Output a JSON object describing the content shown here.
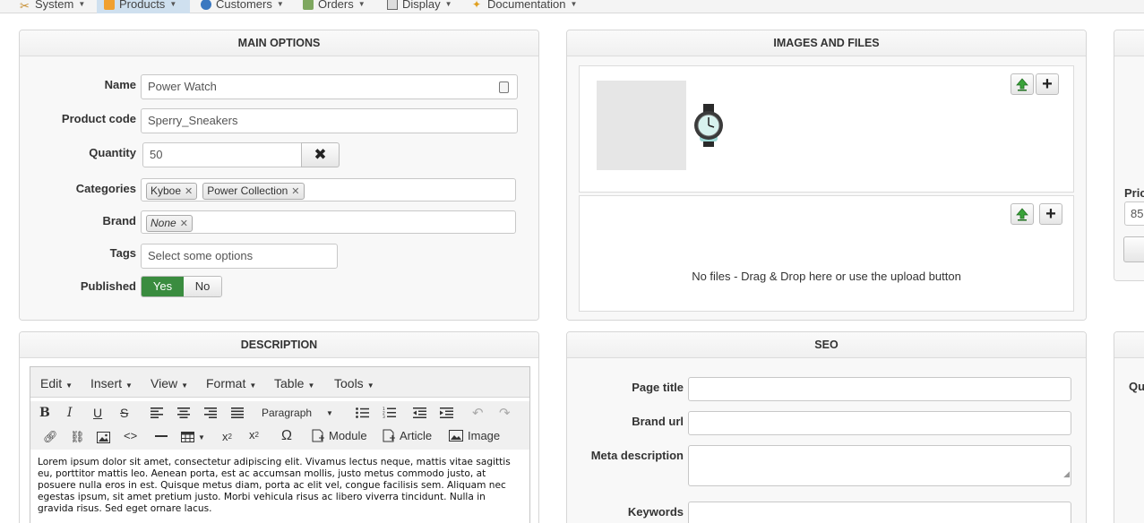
{
  "nav": {
    "items": [
      {
        "label": "System"
      },
      {
        "label": "Products"
      },
      {
        "label": "Customers"
      },
      {
        "label": "Orders"
      },
      {
        "label": "Display"
      },
      {
        "label": "Documentation"
      }
    ]
  },
  "main_options": {
    "title": "MAIN OPTIONS",
    "name_label": "Name",
    "name_value": "Power Watch",
    "code_label": "Product code",
    "code_value": "Sperry_Sneakers",
    "qty_label": "Quantity",
    "qty_value": "50",
    "cat_label": "Categories",
    "categories": [
      "Kyboe",
      "Power Collection"
    ],
    "brand_label": "Brand",
    "brand_value": "None",
    "tags_label": "Tags",
    "tags_placeholder": "Select some options",
    "published_label": "Published",
    "yes_label": "Yes",
    "no_label": "No"
  },
  "images": {
    "title": "IMAGES AND FILES",
    "no_files": "No files - Drag & Drop here or use the upload button"
  },
  "description": {
    "title": "DESCRIPTION",
    "menus": [
      "Edit",
      "Insert",
      "View",
      "Format",
      "Table",
      "Tools"
    ],
    "format_select": "Paragraph",
    "module_label": "Module",
    "article_label": "Article",
    "image_label": "Image",
    "text": "Lorem ipsum dolor sit amet, consectetur adipiscing elit. Vivamus lectus neque, mattis vitae sagittis eu, porttitor mattis leo. Aenean porta, est ac accumsan mollis, justo metus commodo justo, at posuere nulla eros in est. Quisque metus diam, porta ac elit vel, congue facilisis sem. Aliquam nec egestas ipsum, sit amet pretium justo. Morbi vehicula risus ac libero viverra tincidunt. Nulla in gravida risus. Sed eget ornare lacus."
  },
  "seo": {
    "title": "SEO",
    "page_title_label": "Page title",
    "brand_url_label": "Brand url",
    "meta_label": "Meta description",
    "keywords_label": "Keywords"
  },
  "right_partial": {
    "price_label": "Pric",
    "price_value": "85",
    "qu_label": "Qu"
  },
  "colors": {
    "published_yes": "#3a8c3f",
    "upload_green": "#3aa33a"
  }
}
